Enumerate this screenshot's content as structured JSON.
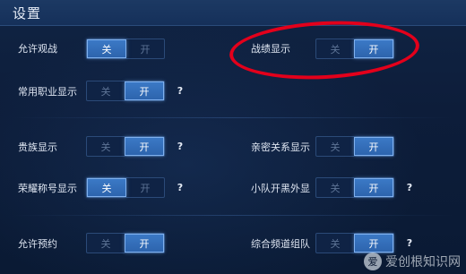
{
  "header": {
    "title": "设置"
  },
  "toggle_labels": {
    "off": "关",
    "on": "开"
  },
  "help_mark": "?",
  "settings": {
    "allow_spectate": {
      "label": "允许观战",
      "state": "off"
    },
    "battle_record": {
      "label": "战绩显示",
      "state": "on"
    },
    "common_role": {
      "label": "常用职业显示",
      "state": "on"
    },
    "noble": {
      "label": "贵族显示",
      "state": "on"
    },
    "intimacy": {
      "label": "亲密关系显示",
      "state": "on"
    },
    "honor_title": {
      "label": "荣耀称号显示",
      "state": "off"
    },
    "team_blacklist": {
      "label": "小队开黑外显",
      "state": "on"
    },
    "allow_reserve": {
      "label": "允许预约",
      "state": "on"
    },
    "channel_team": {
      "label": "综合频道组队",
      "state": "on"
    }
  },
  "watermark": {
    "logo_char": "爱",
    "text": "爱创根知识网"
  },
  "colors": {
    "accent": "#3b79c6",
    "annotation": "#e3001b",
    "background": "#0b1a33"
  }
}
